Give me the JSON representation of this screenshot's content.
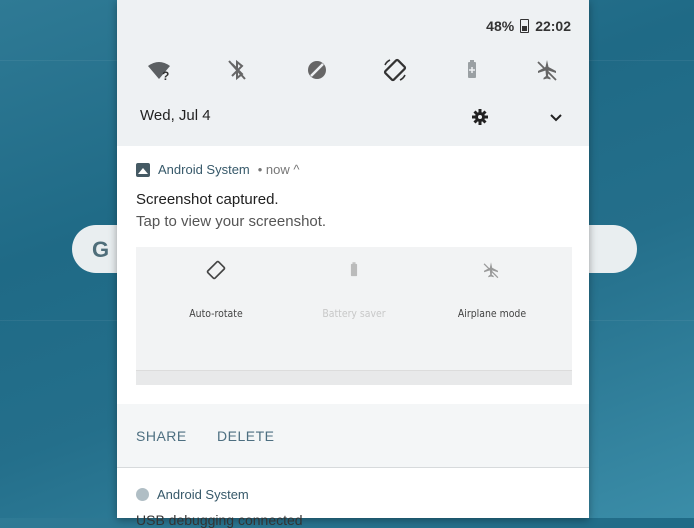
{
  "status": {
    "battery_percent": "48%",
    "time": "22:02"
  },
  "quick_settings": [
    {
      "name": "wifi-question"
    },
    {
      "name": "bluetooth-off"
    },
    {
      "name": "do-not-disturb"
    },
    {
      "name": "auto-rotate"
    },
    {
      "name": "battery-saver"
    },
    {
      "name": "airplane-mode"
    }
  ],
  "date": "Wed, Jul 4",
  "notification": {
    "app": "Android System",
    "meta": "• now ^",
    "title": "Screenshot captured.",
    "text": "Tap to view your screenshot.",
    "preview": {
      "labels": [
        "Auto-rotate",
        "Battery saver",
        "Airplane mode"
      ]
    },
    "actions": [
      "SHARE",
      "DELETE"
    ]
  },
  "notification2": {
    "app": "Android System",
    "text_cut": "USB debugging connected"
  },
  "colors": {
    "accent": "#4d6f81",
    "shade_bg": "#eef1f3"
  }
}
